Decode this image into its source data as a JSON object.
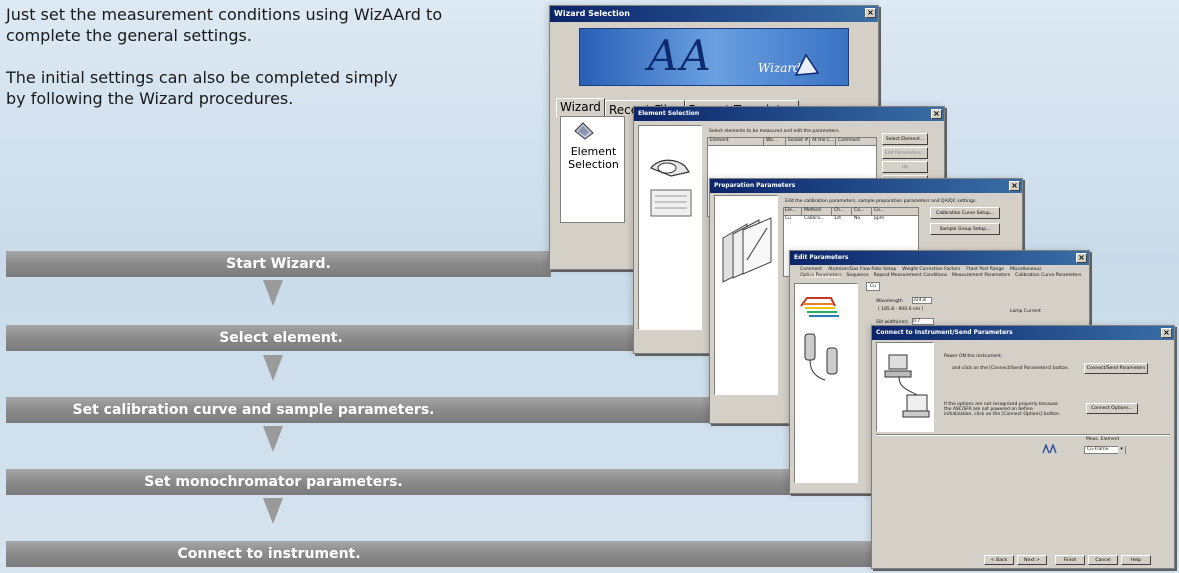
{
  "intro": {
    "line1": "Just set the measurement conditions using WizAArd to",
    "line2": "complete the general settings.",
    "line3": "The initial settings can also be completed simply",
    "line4": "by following the Wizard procedures."
  },
  "steps": [
    "Start Wizard.",
    "Select element.",
    "Set calibration curve and sample parameters.",
    "Set monochromator parameters.",
    "Connect to instrument."
  ],
  "wizard_selection": {
    "title": "Wizard Selection",
    "logo_aa": "AA",
    "logo_wizard": "Wizard",
    "tabs": [
      "Wizard",
      "Recent Files",
      "Recent Templates"
    ],
    "item_label_1": "Element",
    "item_label_2": "Selection"
  },
  "element_selection": {
    "title": "Element Selection",
    "instruction": "Select elements to be measured and edit the parameters.",
    "columns": [
      "Element",
      "Wa...",
      "Socket #",
      "At the C...",
      "Comment"
    ],
    "buttons": [
      "Select Element...",
      "Edit Parameters...",
      "Up",
      "Down"
    ]
  },
  "preparation_parameters": {
    "title": "Preparation Parameters",
    "instruction": "Edit the calibration parameters, sample preparation parameters and QA/QC settings.",
    "columns": [
      "Ele...",
      "Method",
      "Ch...",
      "Ca...",
      "Co..."
    ],
    "row": [
      "Cu",
      "Calibra...",
      "1st",
      "No",
      "ppm"
    ],
    "buttons": [
      "Calibration Curve Setup...",
      "Sample Group Setup..."
    ]
  },
  "edit_parameters": {
    "title": "Edit Parameters",
    "tabs_row1": [
      "Comment",
      "Atomizer/Gas Flow Rate Setup",
      "Weight Correction Factors",
      "Ftant Port Range",
      "Miscellaneous"
    ],
    "tabs_row2": [
      "Optics Parameters",
      "Sequence",
      "Repeat Measurement Conditions",
      "Measurement Parameters",
      "Calibration Curve Parameters"
    ],
    "element": "Cu",
    "wavelength_label": "Wavelength",
    "wavelength_value": "324.8",
    "wavelength_range": "( 185.8 - 900.0 nm )",
    "slit_label": "Slit width(nm)",
    "slit_value": "0.7",
    "lamp_label": "Lamp Current"
  },
  "connect_window": {
    "title": "Connect to Instrument/Send Parameters",
    "line1": "Power ON the instrument,",
    "line2": "and click on the [Connect/Send Parameters] button.",
    "button1": "Connect/Send Parameters",
    "note1": "If the options are not recognized properly because",
    "note2": "the ASC/SFA are not powered on before",
    "note3": "initialization, click on the [Connect Options] button.",
    "button2": "Connect Options...",
    "meas_label": "Meas. Element",
    "meas_value": "Cu-Flame",
    "nav_buttons": [
      "< Back",
      "Next >",
      "Finish",
      "Cancel",
      "Help"
    ]
  },
  "colors": {
    "step_bg": "#8a8a8a",
    "titlebar": "#0a246a",
    "window_face": "#d4d0c8"
  }
}
